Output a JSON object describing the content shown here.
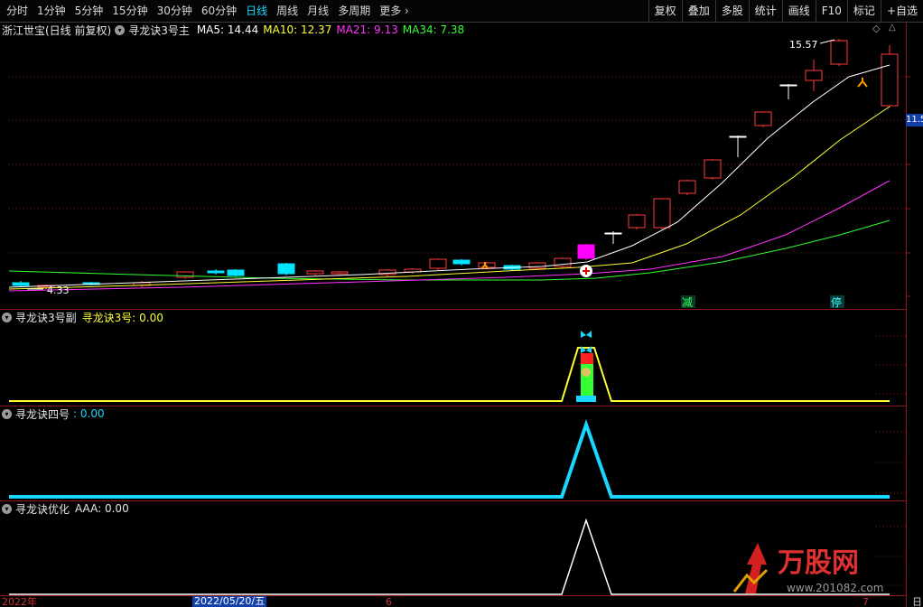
{
  "toolbar": {
    "periods": [
      "分时",
      "1分钟",
      "5分钟",
      "15分钟",
      "30分钟",
      "60分钟",
      "日线",
      "周线",
      "月线",
      "多周期",
      "更多"
    ],
    "active": "日线",
    "right_buttons": [
      "复权",
      "叠加",
      "多股",
      "统计",
      "画线",
      "F10",
      "标记",
      "+自选"
    ]
  },
  "main_panel": {
    "stock_name": "浙江世宝(日线 前复权)",
    "indicator": "寻龙诀3号主",
    "ma": [
      {
        "label": "MA5:",
        "value": "14.44",
        "color": "#ffffff"
      },
      {
        "label": "MA10:",
        "value": "12.37",
        "color": "#ffff33"
      },
      {
        "label": "MA21:",
        "value": "9.13",
        "color": "#ff33ff"
      },
      {
        "label": "MA34:",
        "value": "7.38",
        "color": "#33ff33"
      }
    ],
    "high_label": "15.57",
    "low_label": "4.33",
    "price_tag": "11.5",
    "signal_labels": [
      "减",
      "停"
    ]
  },
  "panel2": {
    "name": "寻龙诀3号副",
    "series": "寻龙诀3号:",
    "value": "0.00"
  },
  "panel3": {
    "name": "寻龙诀四号",
    "series": ":",
    "value": "0.00"
  },
  "panel4": {
    "name": "寻龙诀优化",
    "series": "AAA:",
    "value": "0.00"
  },
  "x_axis": {
    "year_label": "2022年",
    "date_label": "2022/05/20/五",
    "month6": "6",
    "month7": "7",
    "right_label": "日"
  },
  "watermark": {
    "brand": "万股网",
    "url": "www.201082.com"
  },
  "colors": {
    "up": "#ff3b3b",
    "down": "#00e5ff",
    "ma5": "#ffffff",
    "ma10": "#ffff33",
    "ma21": "#ff33ff",
    "ma34": "#33ff33",
    "grid": "#8a1a1a"
  }
}
